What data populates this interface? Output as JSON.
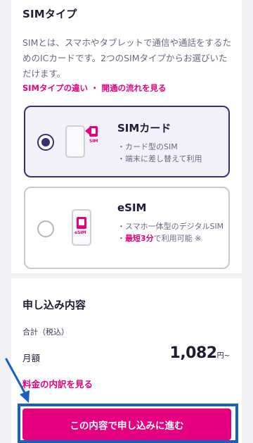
{
  "sim_section": {
    "heading": "SIMタイプ",
    "description": "SIMとは、スマホやタブレットで通信や通話をするためのICカードです。2つのSIMタイプからお選びいただけます。",
    "link_difference": "SIMタイプの違い",
    "link_separator": "・",
    "link_flow": "開通の流れを見る",
    "options": [
      {
        "title": "SIMカード",
        "selected": true,
        "icon_label": "SIM",
        "features": [
          "・カード型のSIM",
          "・端末に差し替えて利用"
        ]
      },
      {
        "title": "eSIM",
        "selected": false,
        "icon_label": "eSIM",
        "features": [
          "・スマホ一体型のデジタルSIM"
        ],
        "highlight_prefix": "・",
        "highlight": "最短3分",
        "highlight_suffix": "で利用可能 ※"
      }
    ]
  },
  "summary": {
    "heading": "申し込み内容",
    "total_label": "合計（税込）",
    "monthly_label": "月額",
    "price": "1,082",
    "price_unit": "円~",
    "breakdown_link": "料金の内訳を見る"
  },
  "cta": {
    "label": "この内容で申し込みに進む"
  },
  "colors": {
    "accent": "#e4007f",
    "selected_border": "#3a2f75",
    "annotation": "#1b5fc4"
  }
}
